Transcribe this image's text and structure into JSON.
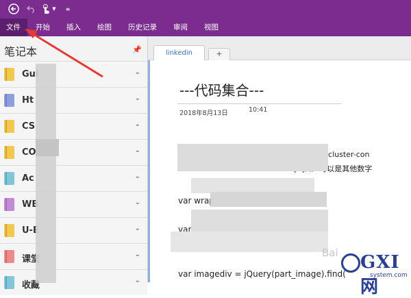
{
  "quick_access": {
    "back_icon": "back-circle-icon",
    "undo_icon": "undo-icon",
    "touch_icon": "touch-mode-icon",
    "more_icon": "customize-icon"
  },
  "ribbon": {
    "tabs": [
      "文件",
      "开始",
      "插入",
      "绘图",
      "历史记录",
      "审阅",
      "视图"
    ]
  },
  "notebooks_pane": {
    "title": "笔记本",
    "pin_icon": "pin-icon",
    "items": [
      {
        "label": "Gui",
        "color": "#f2c94c"
      },
      {
        "label": "Ht",
        "color": "#8e9fe0"
      },
      {
        "label": "CS",
        "color": "#f2c94c"
      },
      {
        "label": "CO",
        "color": "#f2c94c"
      },
      {
        "label": "Ac",
        "color": "#7fc7d9"
      },
      {
        "label": "WB",
        "color": "#c48ad6"
      },
      {
        "label": "U-E",
        "color": "#f2c94c"
      },
      {
        "label": "课堂",
        "color": "#f08a8a"
      },
      {
        "label": "收藏",
        "color": "#7fc7d9"
      }
    ]
  },
  "section_tabs": {
    "active": "linkedin",
    "add_label": "+"
  },
  "page": {
    "title": "---代码集合---",
    "date": "2018年8月13日",
    "time": "10:41",
    "lines": [
      "stcluster-con",
      "[0]; //0可以是其他数字",
      "var wrapp                chidren[0];//这里边的0不",
      "var",
      "v",
      "var imagediv = jQuery(part_image).find("
    ]
  },
  "watermark": {
    "brand": "GXI网",
    "sub": "system.com",
    "baidu": "Bai"
  },
  "colors": {
    "accent": "#7b2c8f",
    "file_tab": "#5b1f6d",
    "arrow": "#e53935"
  }
}
